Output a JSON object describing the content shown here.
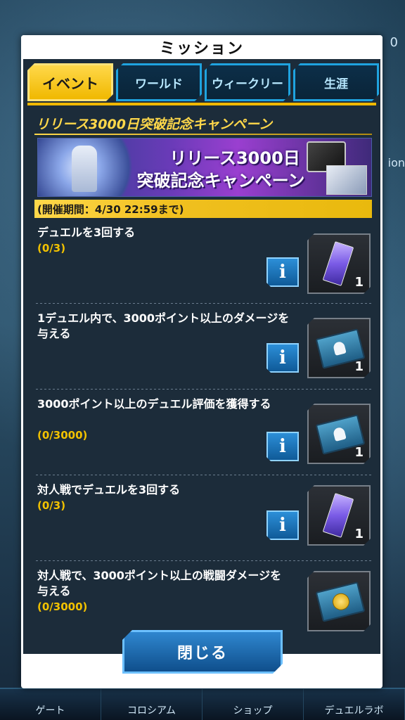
{
  "background": {
    "top_right_text": "0",
    "right_text": "ion"
  },
  "bottom_nav": [
    {
      "label": "ゲート"
    },
    {
      "label": "コロシアム"
    },
    {
      "label": "ショップ"
    },
    {
      "label": "デュエルラボ"
    }
  ],
  "modal": {
    "title": "ミッション",
    "tabs": [
      {
        "label": "イベント",
        "active": true
      },
      {
        "label": "ワールド",
        "active": false
      },
      {
        "label": "ウィークリー",
        "active": false
      },
      {
        "label": "生涯",
        "active": false
      }
    ],
    "campaign_title": "リリース3000日突破記念キャンペーン",
    "banner": {
      "line1": "リリース3000日",
      "line2": "突破記念キャンペーン"
    },
    "period": "(開催期間：4/30 22:59まで)",
    "missions": [
      {
        "text": "デュエルを3回する",
        "progress": "(0/3)",
        "reward_icon": "purple-ticket-icon",
        "reward_count": "1"
      },
      {
        "text": "1デュエル内で、3000ポイント以上のダメージを与える",
        "progress": "",
        "reward_icon": "blue-ticket-icon",
        "reward_count": "1"
      },
      {
        "text": "3000ポイント以上のデュエル評価を獲得する",
        "progress": "(0/3000)",
        "reward_icon": "blue-ticket-icon",
        "reward_count": "1"
      },
      {
        "text": "対人戦でデュエルを3回する",
        "progress": "(0/3)",
        "reward_icon": "purple-ticket-icon",
        "reward_count": "1"
      },
      {
        "text": "対人戦で、3000ポイント以上の戦闘ダメージを与える",
        "progress": "(0/3000)",
        "reward_icon": "gold-ticket-icon",
        "reward_count": ""
      }
    ],
    "info_label": "i",
    "close_label": "閉じる"
  }
}
